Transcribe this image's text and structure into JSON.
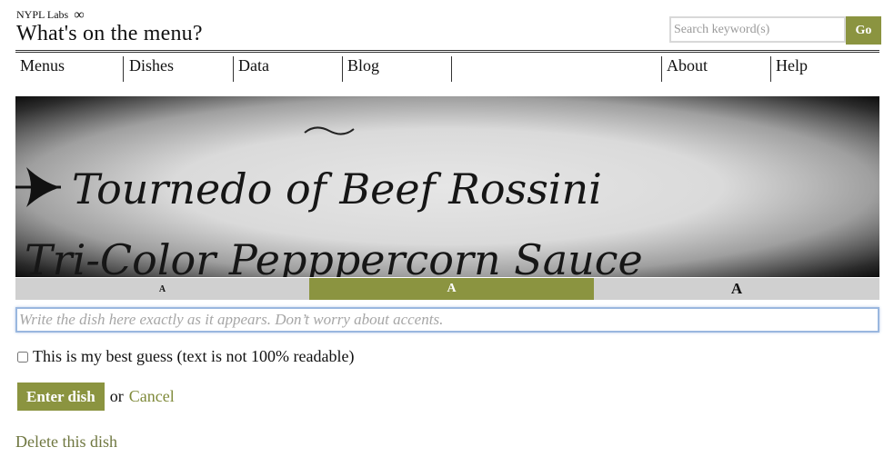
{
  "header": {
    "brand": "NYPL Labs",
    "brand_icon": "infinity-swirl-icon",
    "site_title": "What's on the menu?",
    "search_placeholder": "Search keyword(s)",
    "search_button": "Go"
  },
  "nav": {
    "items": [
      "Menus",
      "Dishes",
      "Data",
      "Blog",
      "About",
      "Help"
    ]
  },
  "image": {
    "line1": "Tournedo of Beef Rossini",
    "line2": "Tri-Color Pepppercorn Sauce",
    "arrow_icon": "arrow-right-icon"
  },
  "font_sizes": {
    "small": "A",
    "medium": "A",
    "large": "A",
    "selected": "medium"
  },
  "dish_input": {
    "placeholder": "Write the dish here exactly as it appears. Don’t worry about accents.",
    "value": ""
  },
  "best_guess_label": "This is my best guess (text is not 100% readable)",
  "enter_button": "Enter dish",
  "or_text": "or",
  "cancel_link": "Cancel",
  "delete_link": "Delete this dish",
  "colors": {
    "accent": "#8b9440",
    "link": "#7f8a3a"
  }
}
